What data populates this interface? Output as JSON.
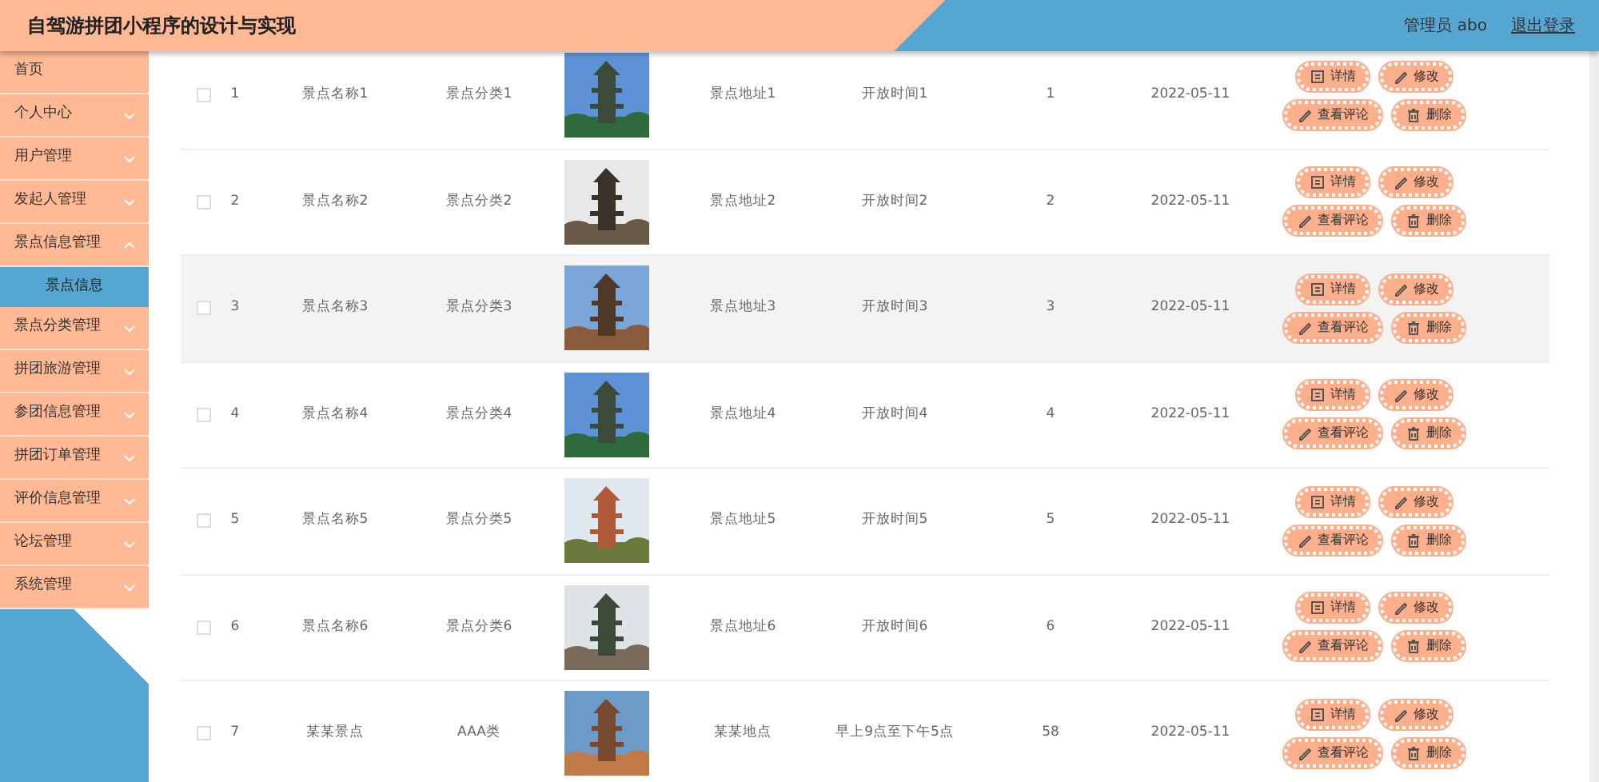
{
  "header": {
    "title": "自驾游拼团小程序的设计与实现",
    "user": "管理员 abo",
    "logout": "退出登录"
  },
  "sidebar": {
    "items": [
      {
        "label": "首页",
        "has_arrow": false
      },
      {
        "label": "个人中心",
        "has_arrow": true,
        "expanded": false
      },
      {
        "label": "用户管理",
        "has_arrow": true,
        "expanded": false
      },
      {
        "label": "发起人管理",
        "has_arrow": true,
        "expanded": false
      },
      {
        "label": "景点信息管理",
        "has_arrow": true,
        "expanded": true,
        "children": [
          {
            "label": "景点信息",
            "selected": true
          }
        ]
      },
      {
        "label": "景点分类管理",
        "has_arrow": true,
        "expanded": false
      },
      {
        "label": "拼团旅游管理",
        "has_arrow": true,
        "expanded": false
      },
      {
        "label": "参团信息管理",
        "has_arrow": true,
        "expanded": false
      },
      {
        "label": "拼团订单管理",
        "has_arrow": true,
        "expanded": false
      },
      {
        "label": "评价信息管理",
        "has_arrow": true,
        "expanded": false
      },
      {
        "label": "论坛管理",
        "has_arrow": true,
        "expanded": false
      },
      {
        "label": "系统管理",
        "has_arrow": true,
        "expanded": false
      }
    ]
  },
  "table": {
    "rows": [
      {
        "checked": false,
        "highlighted": false,
        "index": "1",
        "name": "景点名称1",
        "category": "景点分类1",
        "address": "景点地址1",
        "hours": "开放时间1",
        "count": "1",
        "date": "2022-05-11",
        "actions": [
          {
            "kind": "detail",
            "label": "详情"
          },
          {
            "kind": "edit",
            "label": "修改"
          },
          {
            "kind": "edit",
            "label": "查看评论"
          },
          {
            "kind": "delete",
            "label": "删除"
          }
        ]
      },
      {
        "checked": false,
        "highlighted": false,
        "index": "2",
        "name": "景点名称2",
        "category": "景点分类2",
        "address": "景点地址2",
        "hours": "开放时间2",
        "count": "2",
        "date": "2022-05-11",
        "actions": [
          {
            "kind": "detail",
            "label": "详情"
          },
          {
            "kind": "edit",
            "label": "修改"
          },
          {
            "kind": "edit",
            "label": "查看评论"
          },
          {
            "kind": "delete",
            "label": "删除"
          }
        ]
      },
      {
        "checked": false,
        "highlighted": true,
        "index": "3",
        "name": "景点名称3",
        "category": "景点分类3",
        "address": "景点地址3",
        "hours": "开放时间3",
        "count": "3",
        "date": "2022-05-11",
        "actions": [
          {
            "kind": "detail",
            "label": "详情"
          },
          {
            "kind": "edit",
            "label": "修改"
          },
          {
            "kind": "edit",
            "label": "查看评论"
          },
          {
            "kind": "delete",
            "label": "删除"
          }
        ]
      },
      {
        "checked": false,
        "highlighted": false,
        "index": "4",
        "name": "景点名称4",
        "category": "景点分类4",
        "address": "景点地址4",
        "hours": "开放时间4",
        "count": "4",
        "date": "2022-05-11",
        "actions": [
          {
            "kind": "detail",
            "label": "详情"
          },
          {
            "kind": "edit",
            "label": "修改"
          },
          {
            "kind": "edit",
            "label": "查看评论"
          },
          {
            "kind": "delete",
            "label": "删除"
          }
        ]
      },
      {
        "checked": false,
        "highlighted": false,
        "index": "5",
        "name": "景点名称5",
        "category": "景点分类5",
        "address": "景点地址5",
        "hours": "开放时间5",
        "count": "5",
        "date": "2022-05-11",
        "actions": [
          {
            "kind": "detail",
            "label": "详情"
          },
          {
            "kind": "edit",
            "label": "修改"
          },
          {
            "kind": "edit",
            "label": "查看评论"
          },
          {
            "kind": "delete",
            "label": "删除"
          }
        ]
      },
      {
        "checked": false,
        "highlighted": false,
        "index": "6",
        "name": "景点名称6",
        "category": "景点分类6",
        "address": "景点地址6",
        "hours": "开放时间6",
        "count": "6",
        "date": "2022-05-11",
        "actions": [
          {
            "kind": "detail",
            "label": "详情"
          },
          {
            "kind": "edit",
            "label": "修改"
          },
          {
            "kind": "edit",
            "label": "查看评论"
          },
          {
            "kind": "delete",
            "label": "删除"
          }
        ]
      },
      {
        "checked": false,
        "highlighted": false,
        "index": "7",
        "name": "某某景点",
        "category": "AAA类",
        "address": "某某地点",
        "hours": "早上9点至下午5点",
        "count": "58",
        "date": "2022-05-11",
        "actions": [
          {
            "kind": "detail",
            "label": "详情"
          },
          {
            "kind": "edit",
            "label": "修改"
          },
          {
            "kind": "edit",
            "label": "查看评论"
          },
          {
            "kind": "delete",
            "label": "删除"
          }
        ]
      }
    ]
  }
}
